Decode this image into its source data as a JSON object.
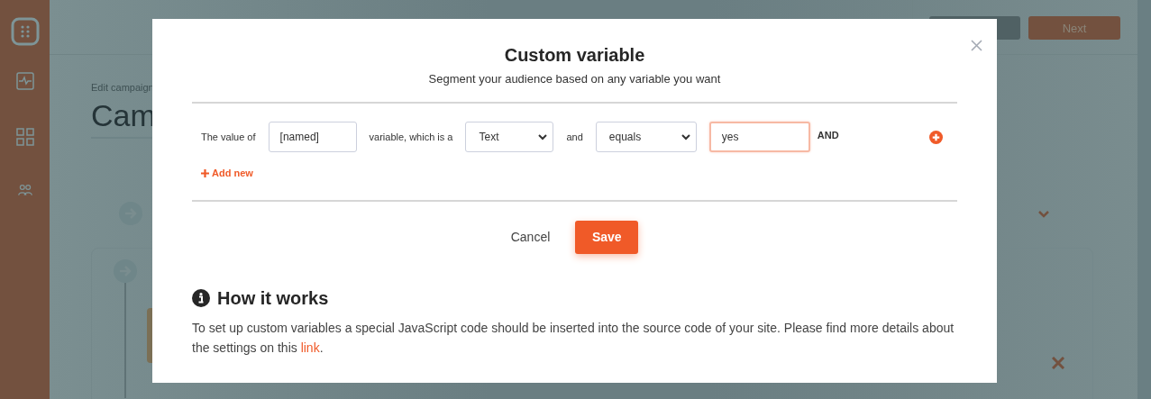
{
  "background": {
    "breadcrumb": "Edit campaign",
    "title": "Cam",
    "next_button": "Next"
  },
  "modal": {
    "title": "Custom variable",
    "subtitle": "Segment your audience based on any variable you want",
    "condition": {
      "prefix": "The value of",
      "name_value": "[named]",
      "type_label": "variable, which is a",
      "type_value": "Text",
      "and_label": "and",
      "operator_value": "equals",
      "value": "yes",
      "value_focused": true,
      "joiner": "AND"
    },
    "add_new": "Add new",
    "cancel": "Cancel",
    "save": "Save",
    "help_title": "How it works",
    "help_text": "To set up custom variables a special JavaScript code should be inserted into the source code of your site. Please find more details about the settings on this ",
    "help_link": "link",
    "help_end": "."
  }
}
